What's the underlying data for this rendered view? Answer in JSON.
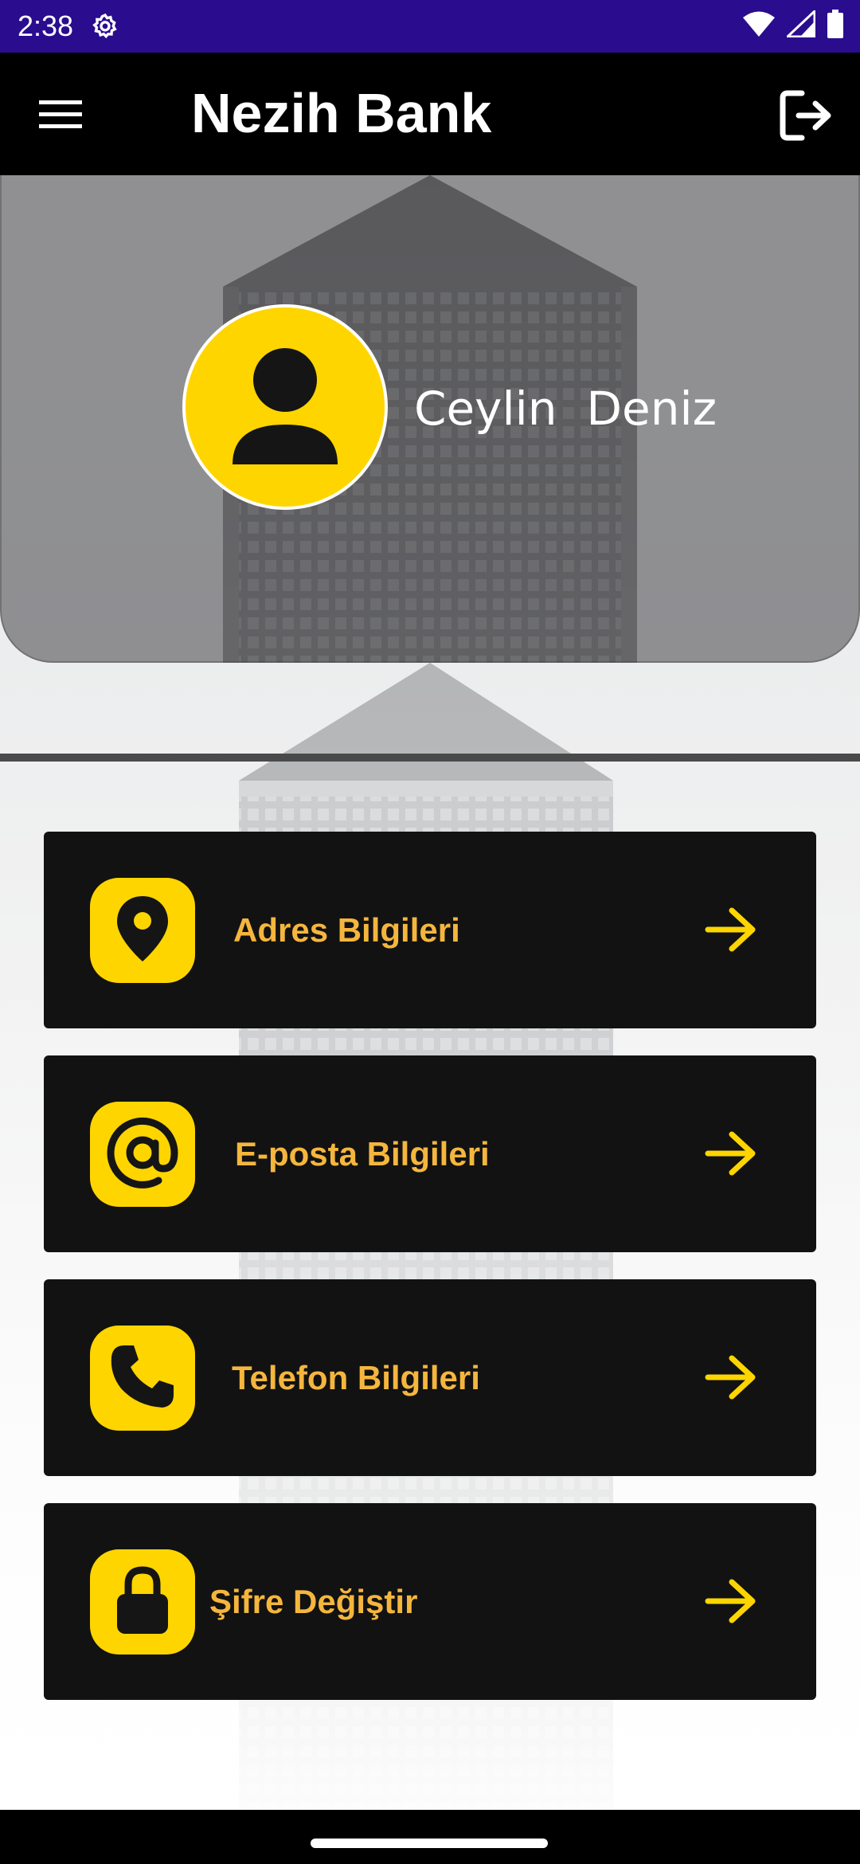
{
  "status_bar": {
    "time": "2:38",
    "icons": [
      "settings-icon",
      "wifi-icon",
      "signal-icon",
      "battery-icon"
    ],
    "background_color": "#2a0c8f"
  },
  "app_bar": {
    "title": "Nezih Bank",
    "menu_icon": "hamburger-menu-icon",
    "logout_icon": "logout-icon"
  },
  "profile": {
    "name": "Ceylin  Deniz",
    "avatar_icon": "person-icon"
  },
  "menu": {
    "items": [
      {
        "label": "Adres Bilgileri",
        "icon": "location-pin-icon"
      },
      {
        "label": "E-posta Bilgileri",
        "icon": "at-sign-icon"
      },
      {
        "label": "Telefon Bilgileri",
        "icon": "phone-icon"
      },
      {
        "label": "Şifre Değiştir",
        "icon": "lock-icon"
      }
    ]
  },
  "colors": {
    "accent_yellow": "#ffd500",
    "label_orange": "#f5b63d",
    "card_background": "#121212"
  }
}
